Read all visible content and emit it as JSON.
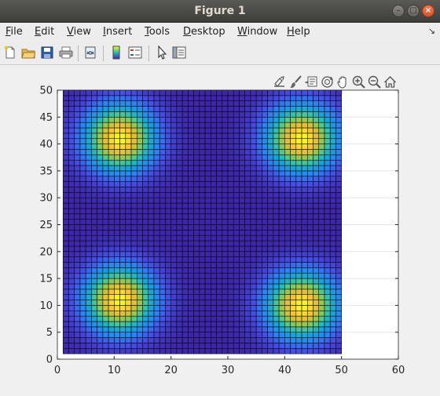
{
  "window": {
    "title": "Figure 1"
  },
  "menu": {
    "items": [
      {
        "label": "File",
        "mnemonic": "F",
        "rest": "ile"
      },
      {
        "label": "Edit",
        "mnemonic": "E",
        "rest": "dit"
      },
      {
        "label": "View",
        "mnemonic": "V",
        "rest": "iew"
      },
      {
        "label": "Insert",
        "mnemonic": "I",
        "rest": "nsert"
      },
      {
        "label": "Tools",
        "mnemonic": "T",
        "rest": "ools"
      },
      {
        "label": "Desktop",
        "mnemonic": "D",
        "rest": "esktop"
      },
      {
        "label": "Window",
        "mnemonic": "W",
        "rest": "indow"
      },
      {
        "label": "Help",
        "mnemonic": "H",
        "rest": "elp"
      }
    ]
  },
  "toolbar": {
    "icons": [
      "new-figure-icon",
      "open-file-icon",
      "save-icon",
      "print-icon",
      "link-plot-icon",
      "colorbar-icon",
      "legend-icon",
      "edit-plot-icon",
      "property-inspector-icon"
    ]
  },
  "axes_toolbar": {
    "icons": [
      "export-icon",
      "brush-icon",
      "datatips-icon",
      "rotate-icon",
      "pan-icon",
      "zoom-in-icon",
      "zoom-out-icon",
      "home-icon"
    ]
  },
  "chart_data": {
    "type": "heatmap",
    "title": "",
    "xlabel": "",
    "ylabel": "",
    "xlim": [
      0,
      60
    ],
    "ylim": [
      0,
      50
    ],
    "xticks": [
      0,
      10,
      20,
      30,
      40,
      50,
      60
    ],
    "yticks": [
      0,
      5,
      10,
      15,
      20,
      25,
      30,
      35,
      40,
      45,
      50
    ],
    "grid": {
      "cols": 49,
      "rows": 49,
      "x_range": [
        1,
        50
      ],
      "y_range": [
        1,
        50
      ]
    },
    "peaks": [
      {
        "x": 11,
        "y": 41,
        "amplitude": 1.0,
        "sigma": 4.2
      },
      {
        "x": 43,
        "y": 41,
        "amplitude": 1.0,
        "sigma": 4.2
      },
      {
        "x": 11,
        "y": 11,
        "amplitude": 1.0,
        "sigma": 4.2
      },
      {
        "x": 43,
        "y": 10,
        "amplitude": 1.0,
        "sigma": 4.2
      }
    ],
    "colormap": "parula",
    "edge_color": "#000000",
    "gridlines": true
  }
}
